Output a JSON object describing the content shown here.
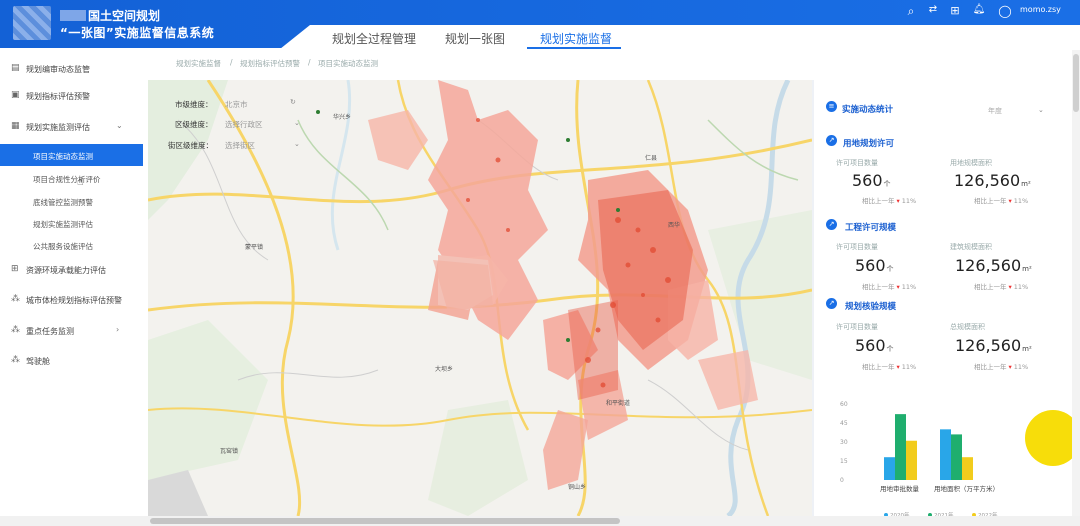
{
  "header": {
    "title_line1": "国土空间规划",
    "title_line2": "“一张图”实施监督信息系统",
    "tabs": [
      "规划全过程管理",
      "规划一张图",
      "规划实施监督"
    ],
    "active_tab": 2,
    "user": "momo.zsy",
    "icons": [
      "search-icon",
      "swap-icon",
      "grid-icon",
      "bell-icon",
      "user-icon"
    ]
  },
  "sidebar": {
    "items": [
      {
        "label": "规划编审动态监管",
        "icon": "doc-icon"
      },
      {
        "label": "规划指标评估预警",
        "icon": "monitor-icon"
      },
      {
        "label": "规划实施监测评估",
        "icon": "folder-icon",
        "expanded": true
      },
      {
        "label": "资源环境承载能力评估",
        "icon": "grid-icon"
      },
      {
        "label": "城市体检规划指标评估预警",
        "icon": "nodes-icon"
      },
      {
        "label": "重点任务监测",
        "icon": "nodes-icon"
      },
      {
        "label": "驾驶舱",
        "icon": "nodes-icon"
      }
    ],
    "sub_items": [
      "项目实施动态监测",
      "项目合规性分析评价",
      "底线管控监测预警",
      "规划实施监测评估",
      "公共服务设施评估"
    ],
    "active_sub": 0
  },
  "breadcrumb": [
    "规划实施监督",
    "/",
    "规划指标评估预警",
    "/",
    "项目实施动态监测"
  ],
  "filters": [
    {
      "label": "市级维度：",
      "value": "北京市"
    },
    {
      "label": "区级维度：",
      "value": "选择行政区"
    },
    {
      "label": "街区级维度：",
      "value": "选择街区"
    }
  ],
  "map_labels": [
    "蒙平镇",
    "大坝乡",
    "瓦窑镇",
    "和平街道",
    "仁县",
    "西华",
    "铜山乡",
    "华兴乡"
  ],
  "stats": {
    "title": "实施动态统计",
    "year_placeholder": "年度",
    "trend_label": "相比上一年",
    "sections": [
      {
        "title": "用地规划许可",
        "left_label": "许可项目数量",
        "left_value": "560",
        "left_unit": "个",
        "right_label": "用地规模面积",
        "right_value": "126,560",
        "right_unit": "m²",
        "left_trend": "11%",
        "right_trend": "11%"
      },
      {
        "title": "工程许可规模",
        "left_label": "许可项目数量",
        "left_value": "560",
        "left_unit": "个",
        "right_label": "建筑规模面积",
        "right_value": "126,560",
        "right_unit": "m²",
        "left_trend": "11%",
        "right_trend": "11%"
      },
      {
        "title": "规划核验规模",
        "left_label": "许可项目数量",
        "left_value": "560",
        "left_unit": "个",
        "right_label": "总规模面积",
        "right_value": "126,560",
        "right_unit": "m²",
        "left_trend": "11%",
        "right_trend": "11%"
      }
    ]
  },
  "chart_data": {
    "type": "bar",
    "categories": [
      "用地审批数量",
      "用地面积（万平方米）"
    ],
    "series": [
      {
        "name": "2020年",
        "values": [
          18,
          40
        ],
        "color": "#29a6e8"
      },
      {
        "name": "2021年",
        "values": [
          52,
          36
        ],
        "color": "#1fae6e"
      },
      {
        "name": "2022年",
        "values": [
          31,
          18
        ],
        "color": "#f2cc1c"
      }
    ],
    "yticks": [
      0,
      15,
      30,
      45,
      60
    ],
    "ylim": [
      0,
      60
    ]
  },
  "colors": {
    "primary": "#1a6fe6",
    "accent_yellow": "#f7dd0a",
    "map_parcel": "#f08a7a"
  }
}
